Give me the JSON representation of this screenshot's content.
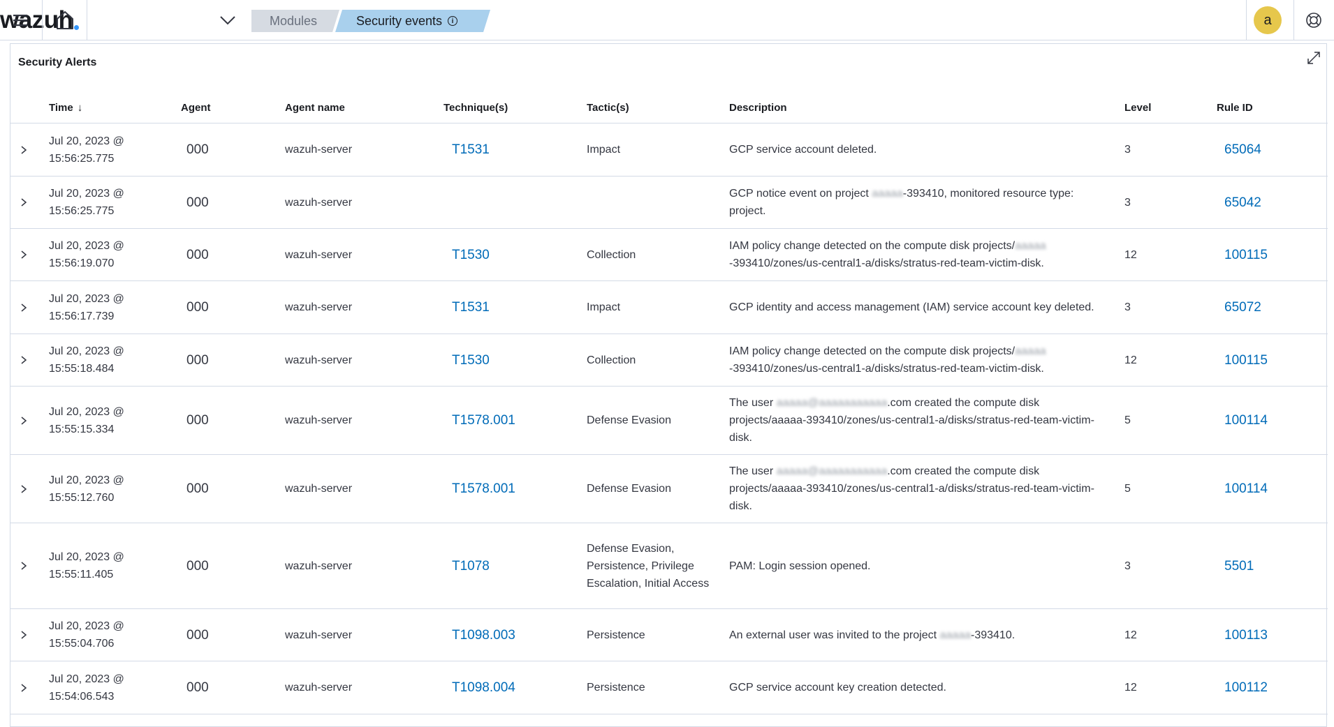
{
  "header": {
    "menu_icon": "hamburger-icon",
    "home_icon": "home-icon",
    "logo_text": "wazuh",
    "logo_dot": ".",
    "dropdown_icon": "chevron-down-icon",
    "breadcrumbs": [
      "Modules",
      "Security events"
    ],
    "info_glyph": "i",
    "avatar_letter": "a",
    "help_icon": "help-lifebuoy-icon",
    "colors": {
      "accent": "#3595f9",
      "crumb_active": "#a9d0ed",
      "crumb_inactive": "#d6dbe2",
      "avatar": "#e6c74c",
      "link": "#006bb8"
    }
  },
  "panel": {
    "title": "Security Alerts",
    "expand_icon": "fullscreen-icon",
    "columns": {
      "time": "Time",
      "agent": "Agent",
      "agent_name": "Agent name",
      "techniques": "Technique(s)",
      "tactics": "Tactic(s)",
      "description": "Description",
      "level": "Level",
      "rule_id": "Rule ID"
    },
    "sort_glyph": "↓",
    "rows": [
      {
        "time_date": "Jul 20, 2023 @",
        "time_clock": "15:56:25.775",
        "agent": "000",
        "agent_name": "wazuh-server",
        "technique": "T1531",
        "tactic": "Impact",
        "desc": [
          "GCP service account deleted."
        ],
        "level": "3",
        "rule_id": "65064"
      },
      {
        "time_date": "Jul 20, 2023 @",
        "time_clock": "15:56:25.775",
        "agent": "000",
        "agent_name": "wazuh-server",
        "technique": "",
        "tactic": "",
        "desc_pre": "GCP notice event on project ",
        "desc_blur": "aaaaa",
        "desc_post": "-393410, monitored resource type: project.",
        "level": "3",
        "rule_id": "65042"
      },
      {
        "time_date": "Jul 20, 2023 @",
        "time_clock": "15:56:19.070",
        "agent": "000",
        "agent_name": "wazuh-server",
        "technique": "T1530",
        "tactic": "Collection",
        "desc_pre": "IAM policy change detected on the compute disk projects/",
        "desc_blur": "aaaaa",
        "desc_post": "-393410/zones/us-central1-a/disks/stratus-red-team-victim-disk.",
        "level": "12",
        "rule_id": "100115"
      },
      {
        "time_date": "Jul 20, 2023 @",
        "time_clock": "15:56:17.739",
        "agent": "000",
        "agent_name": "wazuh-server",
        "technique": "T1531",
        "tactic": "Impact",
        "desc_pre": "GCP identity and access management (IAM) service account key deleted.",
        "desc_blur": "",
        "desc_post": "",
        "level": "3",
        "rule_id": "65072"
      },
      {
        "time_date": "Jul 20, 2023 @",
        "time_clock": "15:55:18.484",
        "agent": "000",
        "agent_name": "wazuh-server",
        "technique": "T1530",
        "tactic": "Collection",
        "desc_pre": "IAM policy change detected on the compute disk projects/",
        "desc_blur": "aaaaa",
        "desc_post": "-393410/zones/us-central1-a/disks/stratus-red-team-victim-disk.",
        "level": "12",
        "rule_id": "100115"
      },
      {
        "time_date": "Jul 20, 2023 @",
        "time_clock": "15:55:15.334",
        "agent": "000",
        "agent_name": "wazuh-server",
        "technique": "T1578.001",
        "tactic": "Defense Evasion",
        "desc_pre": "The user ",
        "desc_blur": "aaaaa@aaaaaaaaaaa",
        "desc_post": ".com created the compute disk projects/aaaaa-393410/zones/us-central1-a/disks/stratus-red-team-victim-disk.",
        "level": "5",
        "rule_id": "100114"
      },
      {
        "time_date": "Jul 20, 2023 @",
        "time_clock": "15:55:12.760",
        "agent": "000",
        "agent_name": "wazuh-server",
        "technique": "T1578.001",
        "tactic": "Defense Evasion",
        "desc_pre": "The user ",
        "desc_blur": "aaaaa@aaaaaaaaaaa",
        "desc_post": ".com created the compute disk projects/aaaaa-393410/zones/us-central1-a/disks/stratus-red-team-victim-disk.",
        "level": "5",
        "rule_id": "100114"
      },
      {
        "time_date": "Jul 20, 2023 @",
        "time_clock": "15:55:11.405",
        "agent": "000",
        "agent_name": "wazuh-server",
        "technique": "T1078",
        "tactic": "Defense Evasion, Persistence, Privilege Escalation, Initial Access",
        "desc_pre": "PAM: Login session opened.",
        "desc_blur": "",
        "desc_post": "",
        "level": "3",
        "rule_id": "5501"
      },
      {
        "time_date": "Jul 20, 2023 @",
        "time_clock": "15:55:04.706",
        "agent": "000",
        "agent_name": "wazuh-server",
        "technique": "T1098.003",
        "tactic": "Persistence",
        "desc_pre": "An external user was invited to the project ",
        "desc_blur": "aaaaa",
        "desc_post": "-393410.",
        "level": "12",
        "rule_id": "100113"
      },
      {
        "time_date": "Jul 20, 2023 @",
        "time_clock": "15:54:06.543",
        "agent": "000",
        "agent_name": "wazuh-server",
        "technique": "T1098.004",
        "tactic": "Persistence",
        "desc_pre": "GCP service account key creation detected.",
        "desc_blur": "",
        "desc_post": "",
        "level": "12",
        "rule_id": "100112"
      }
    ]
  }
}
